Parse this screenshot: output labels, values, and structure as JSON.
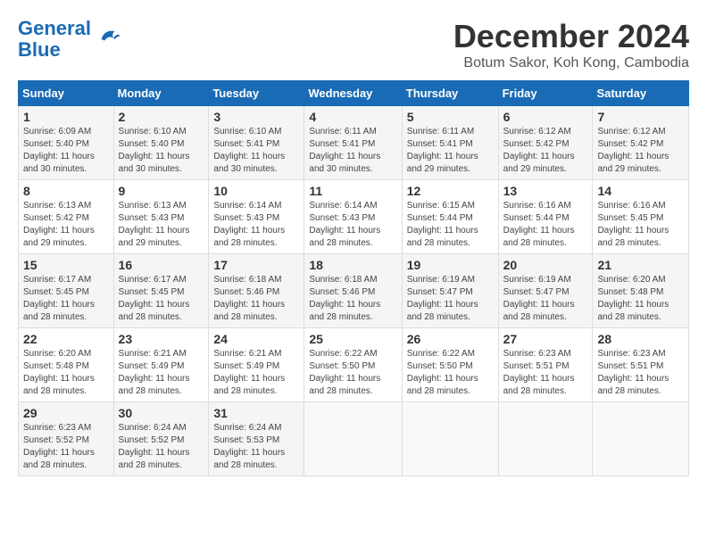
{
  "header": {
    "logo_line1": "General",
    "logo_line2": "Blue",
    "month": "December 2024",
    "location": "Botum Sakor, Koh Kong, Cambodia"
  },
  "days_of_week": [
    "Sunday",
    "Monday",
    "Tuesday",
    "Wednesday",
    "Thursday",
    "Friday",
    "Saturday"
  ],
  "weeks": [
    [
      {
        "day": "1",
        "sunrise": "6:09 AM",
        "sunset": "5:40 PM",
        "daylight": "11 hours and 30 minutes."
      },
      {
        "day": "2",
        "sunrise": "6:10 AM",
        "sunset": "5:40 PM",
        "daylight": "11 hours and 30 minutes."
      },
      {
        "day": "3",
        "sunrise": "6:10 AM",
        "sunset": "5:41 PM",
        "daylight": "11 hours and 30 minutes."
      },
      {
        "day": "4",
        "sunrise": "6:11 AM",
        "sunset": "5:41 PM",
        "daylight": "11 hours and 30 minutes."
      },
      {
        "day": "5",
        "sunrise": "6:11 AM",
        "sunset": "5:41 PM",
        "daylight": "11 hours and 29 minutes."
      },
      {
        "day": "6",
        "sunrise": "6:12 AM",
        "sunset": "5:42 PM",
        "daylight": "11 hours and 29 minutes."
      },
      {
        "day": "7",
        "sunrise": "6:12 AM",
        "sunset": "5:42 PM",
        "daylight": "11 hours and 29 minutes."
      }
    ],
    [
      {
        "day": "8",
        "sunrise": "6:13 AM",
        "sunset": "5:42 PM",
        "daylight": "11 hours and 29 minutes."
      },
      {
        "day": "9",
        "sunrise": "6:13 AM",
        "sunset": "5:43 PM",
        "daylight": "11 hours and 29 minutes."
      },
      {
        "day": "10",
        "sunrise": "6:14 AM",
        "sunset": "5:43 PM",
        "daylight": "11 hours and 28 minutes."
      },
      {
        "day": "11",
        "sunrise": "6:14 AM",
        "sunset": "5:43 PM",
        "daylight": "11 hours and 28 minutes."
      },
      {
        "day": "12",
        "sunrise": "6:15 AM",
        "sunset": "5:44 PM",
        "daylight": "11 hours and 28 minutes."
      },
      {
        "day": "13",
        "sunrise": "6:16 AM",
        "sunset": "5:44 PM",
        "daylight": "11 hours and 28 minutes."
      },
      {
        "day": "14",
        "sunrise": "6:16 AM",
        "sunset": "5:45 PM",
        "daylight": "11 hours and 28 minutes."
      }
    ],
    [
      {
        "day": "15",
        "sunrise": "6:17 AM",
        "sunset": "5:45 PM",
        "daylight": "11 hours and 28 minutes."
      },
      {
        "day": "16",
        "sunrise": "6:17 AM",
        "sunset": "5:45 PM",
        "daylight": "11 hours and 28 minutes."
      },
      {
        "day": "17",
        "sunrise": "6:18 AM",
        "sunset": "5:46 PM",
        "daylight": "11 hours and 28 minutes."
      },
      {
        "day": "18",
        "sunrise": "6:18 AM",
        "sunset": "5:46 PM",
        "daylight": "11 hours and 28 minutes."
      },
      {
        "day": "19",
        "sunrise": "6:19 AM",
        "sunset": "5:47 PM",
        "daylight": "11 hours and 28 minutes."
      },
      {
        "day": "20",
        "sunrise": "6:19 AM",
        "sunset": "5:47 PM",
        "daylight": "11 hours and 28 minutes."
      },
      {
        "day": "21",
        "sunrise": "6:20 AM",
        "sunset": "5:48 PM",
        "daylight": "11 hours and 28 minutes."
      }
    ],
    [
      {
        "day": "22",
        "sunrise": "6:20 AM",
        "sunset": "5:48 PM",
        "daylight": "11 hours and 28 minutes."
      },
      {
        "day": "23",
        "sunrise": "6:21 AM",
        "sunset": "5:49 PM",
        "daylight": "11 hours and 28 minutes."
      },
      {
        "day": "24",
        "sunrise": "6:21 AM",
        "sunset": "5:49 PM",
        "daylight": "11 hours and 28 minutes."
      },
      {
        "day": "25",
        "sunrise": "6:22 AM",
        "sunset": "5:50 PM",
        "daylight": "11 hours and 28 minutes."
      },
      {
        "day": "26",
        "sunrise": "6:22 AM",
        "sunset": "5:50 PM",
        "daylight": "11 hours and 28 minutes."
      },
      {
        "day": "27",
        "sunrise": "6:23 AM",
        "sunset": "5:51 PM",
        "daylight": "11 hours and 28 minutes."
      },
      {
        "day": "28",
        "sunrise": "6:23 AM",
        "sunset": "5:51 PM",
        "daylight": "11 hours and 28 minutes."
      }
    ],
    [
      {
        "day": "29",
        "sunrise": "6:23 AM",
        "sunset": "5:52 PM",
        "daylight": "11 hours and 28 minutes."
      },
      {
        "day": "30",
        "sunrise": "6:24 AM",
        "sunset": "5:52 PM",
        "daylight": "11 hours and 28 minutes."
      },
      {
        "day": "31",
        "sunrise": "6:24 AM",
        "sunset": "5:53 PM",
        "daylight": "11 hours and 28 minutes."
      },
      null,
      null,
      null,
      null
    ]
  ],
  "labels": {
    "sunrise": "Sunrise:",
    "sunset": "Sunset:",
    "daylight": "Daylight:"
  }
}
